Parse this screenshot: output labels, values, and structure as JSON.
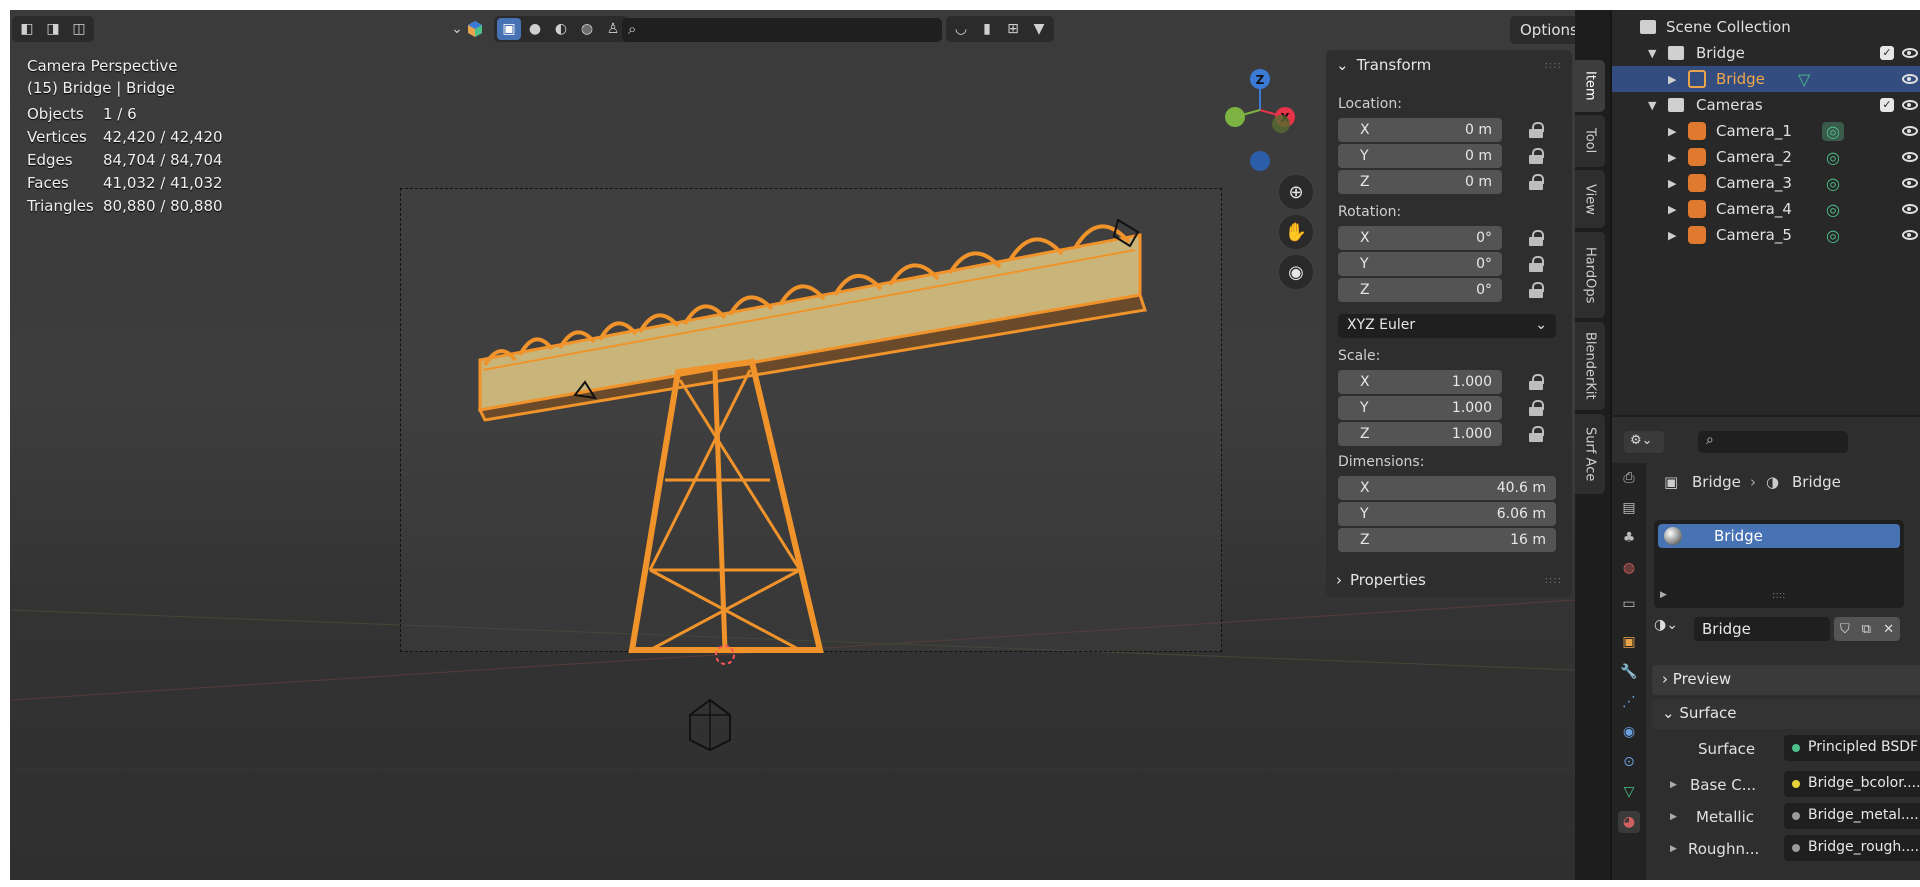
{
  "viewport": {
    "overlay_title": "Camera Perspective",
    "overlay_subtitle": "(15) Bridge | Bridge",
    "stats": [
      {
        "label": "Objects",
        "value": "1 / 6"
      },
      {
        "label": "Vertices",
        "value": "42,420 / 42,420"
      },
      {
        "label": "Edges",
        "value": "84,704 / 84,704"
      },
      {
        "label": "Faces",
        "value": "41,032 / 41,032"
      },
      {
        "label": "Triangles",
        "value": "80,880 / 80,880"
      }
    ],
    "options_label": "Options",
    "gizmo": {
      "x": "X",
      "y": "Y",
      "z": "Z"
    },
    "colors": {
      "accent": "#4772b3",
      "selection": "#f0932b",
      "x_axis": "#e8334b",
      "y_axis": "#7cb342",
      "z_axis": "#3b7bd6"
    }
  },
  "npanel": {
    "transform_title": "Transform",
    "location_label": "Location:",
    "location": [
      {
        "axis": "X",
        "value": "0 m"
      },
      {
        "axis": "Y",
        "value": "0 m"
      },
      {
        "axis": "Z",
        "value": "0 m"
      }
    ],
    "rotation_label": "Rotation:",
    "rotation": [
      {
        "axis": "X",
        "value": "0°"
      },
      {
        "axis": "Y",
        "value": "0°"
      },
      {
        "axis": "Z",
        "value": "0°"
      }
    ],
    "rotation_mode": "XYZ Euler",
    "scale_label": "Scale:",
    "scale": [
      {
        "axis": "X",
        "value": "1.000"
      },
      {
        "axis": "Y",
        "value": "1.000"
      },
      {
        "axis": "Z",
        "value": "1.000"
      }
    ],
    "dimensions_label": "Dimensions:",
    "dimensions": [
      {
        "axis": "X",
        "value": "40.6 m"
      },
      {
        "axis": "Y",
        "value": "6.06 m"
      },
      {
        "axis": "Z",
        "value": "16 m"
      }
    ],
    "properties_title": "Properties",
    "tabs": [
      "Item",
      "Tool",
      "View",
      "HardOps",
      "BlenderKit",
      "Surf Ace"
    ]
  },
  "outliner": {
    "scene_collection": "Scene Collection",
    "items": [
      {
        "label": "Bridge",
        "type": "collection"
      },
      {
        "label": "Bridge",
        "type": "mesh"
      },
      {
        "label": "Cameras",
        "type": "collection"
      },
      {
        "label": "Camera_1",
        "type": "camera"
      },
      {
        "label": "Camera_2",
        "type": "camera"
      },
      {
        "label": "Camera_3",
        "type": "camera"
      },
      {
        "label": "Camera_4",
        "type": "camera"
      },
      {
        "label": "Camera_5",
        "type": "camera"
      }
    ]
  },
  "properties": {
    "breadcrumb_object": "Bridge",
    "breadcrumb_material": "Bridge",
    "material_slot": "Bridge",
    "material_name": "Bridge",
    "preview_label": "Preview",
    "surface_section": "Surface",
    "surface_label": "Surface",
    "surface_value": "Principled BSDF",
    "inputs": [
      {
        "label": "Base C...",
        "value": "Bridge_bcolor...."
      },
      {
        "label": "Metallic",
        "value": "Bridge_metal...."
      },
      {
        "label": "Roughn...",
        "value": "Bridge_rough...."
      }
    ]
  }
}
